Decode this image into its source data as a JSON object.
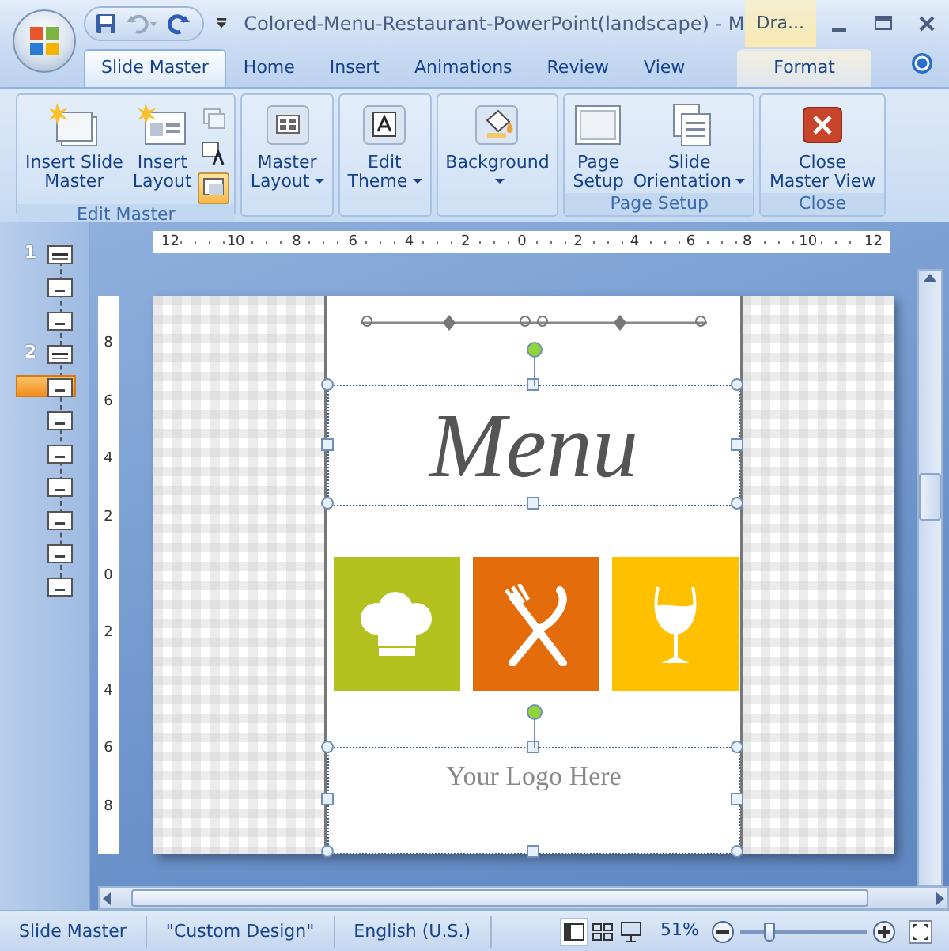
{
  "window": {
    "title": "Colored-Menu-Restaurant-PowerPoint(landscape) - M",
    "contextual_tab": "Dra..."
  },
  "tabs": [
    {
      "label": "Slide Master",
      "selected": true
    },
    {
      "label": "Home",
      "selected": false
    },
    {
      "label": "Insert",
      "selected": false
    },
    {
      "label": "Animations",
      "selected": false
    },
    {
      "label": "Review",
      "selected": false
    },
    {
      "label": "View",
      "selected": false
    },
    {
      "label": "Format",
      "selected": false
    }
  ],
  "ribbon_groups": [
    {
      "label": "Edit Master",
      "buttons": [
        {
          "kind": "insert-master",
          "lines": [
            "Insert Slide",
            "Master"
          ],
          "dropdown": false
        },
        {
          "kind": "insert-layout",
          "lines": [
            "Insert",
            "Layout"
          ],
          "dropdown": false
        }
      ],
      "small_tools": [
        {
          "disabled": true,
          "selected": false
        },
        {
          "disabled": false,
          "selected": false
        },
        {
          "disabled": false,
          "selected": true
        }
      ]
    },
    {
      "buttons": [
        {
          "kind": "layout",
          "lines": [
            "Master",
            "Layout"
          ],
          "dropdown": true
        }
      ]
    },
    {
      "buttons": [
        {
          "kind": "theme",
          "lines": [
            "Edit",
            "Theme"
          ],
          "dropdown": true
        }
      ]
    },
    {
      "buttons": [
        {
          "kind": "background",
          "lines": [
            "Background"
          ],
          "dropdown": true
        }
      ]
    },
    {
      "label": "Page Setup",
      "buttons": [
        {
          "kind": "page",
          "lines": [
            "Page",
            "Setup"
          ],
          "dropdown": false
        },
        {
          "kind": "orientation",
          "lines": [
            "Slide",
            "Orientation"
          ],
          "dropdown": true
        }
      ]
    },
    {
      "label": "Close",
      "buttons": [
        {
          "kind": "close",
          "lines": [
            "Close",
            "Master View"
          ],
          "dropdown": false
        }
      ]
    }
  ],
  "thumbnails": [
    {
      "number": "1",
      "kind": "master",
      "selected": false
    },
    {
      "kind": "layout",
      "selected": false
    },
    {
      "kind": "layout",
      "selected": false
    },
    {
      "number": "2",
      "kind": "master",
      "selected": false
    },
    {
      "kind": "layout",
      "selected": true
    },
    {
      "kind": "layout",
      "selected": false
    },
    {
      "kind": "layout",
      "selected": false
    },
    {
      "kind": "layout",
      "selected": false
    },
    {
      "kind": "layout",
      "selected": false
    },
    {
      "kind": "layout",
      "selected": false
    },
    {
      "kind": "layout",
      "selected": false
    }
  ],
  "horizontal_ruler": [
    "12",
    "10",
    "8",
    "6",
    "4",
    "2",
    "0",
    "2",
    "4",
    "6",
    "8",
    "10",
    "12"
  ],
  "vertical_ruler": [
    "8",
    "6",
    "4",
    "2",
    "0",
    "2",
    "4",
    "6",
    "8"
  ],
  "slide": {
    "title": "Menu",
    "tiles": [
      {
        "kind": "chef-hat",
        "color": "#b3c11f"
      },
      {
        "kind": "cutlery",
        "color": "#e46c0a"
      },
      {
        "kind": "wine-glass",
        "color": "#ffc000"
      }
    ],
    "logo_text": "Your Logo Here"
  },
  "status_bar": {
    "items": [
      "Slide Master",
      "\"Custom Design\"",
      "English (U.S.)"
    ],
    "views": [
      {
        "kind": "normal",
        "selected": true
      },
      {
        "kind": "sorter",
        "selected": false
      },
      {
        "kind": "slideshow",
        "selected": false
      }
    ],
    "zoom": "51%",
    "zoom_slider": {
      "level": 0.23
    }
  }
}
